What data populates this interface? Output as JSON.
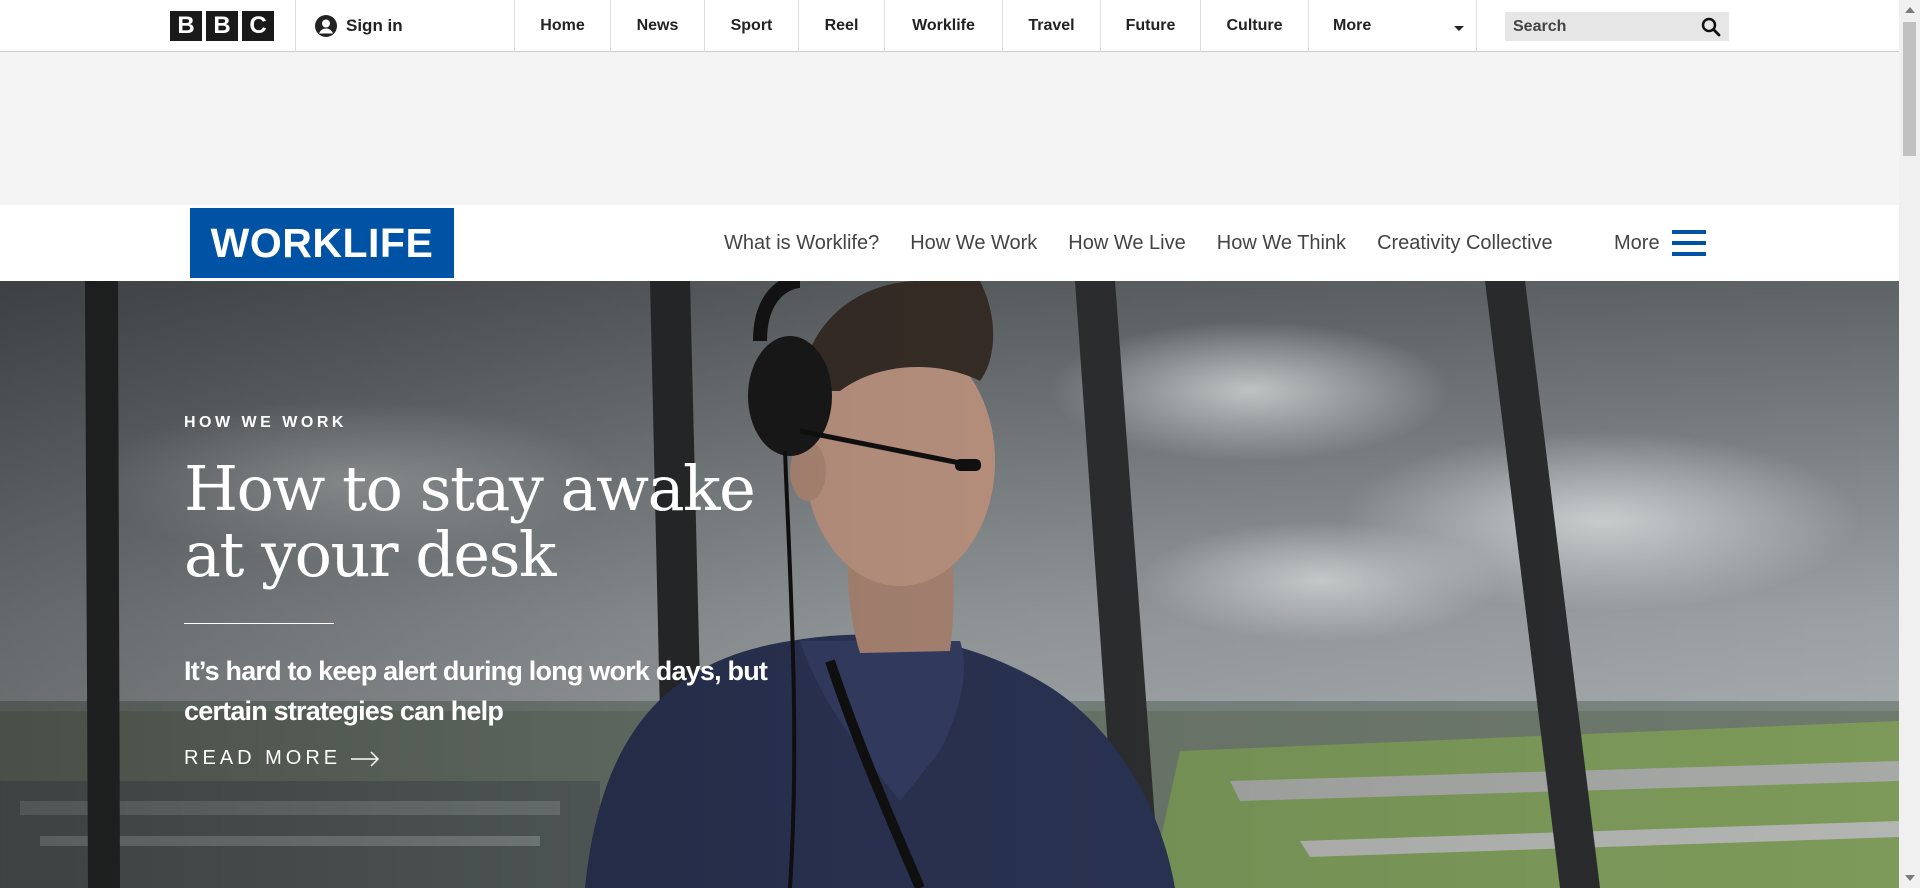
{
  "bbc": {
    "logo_letters": [
      "B",
      "B",
      "C"
    ],
    "sign_in": "Sign in",
    "nav": [
      {
        "label": "Home"
      },
      {
        "label": "News"
      },
      {
        "label": "Sport"
      },
      {
        "label": "Reel"
      },
      {
        "label": "Worklife"
      },
      {
        "label": "Travel"
      },
      {
        "label": "Future"
      },
      {
        "label": "Culture"
      }
    ],
    "more_label": "More",
    "search_label": "Search"
  },
  "worklife": {
    "logo": "WORKLIFE",
    "nav": [
      {
        "label": "What is Worklife?"
      },
      {
        "label": "How We Work"
      },
      {
        "label": "How We Live"
      },
      {
        "label": "How We Think"
      },
      {
        "label": "Creativity Collective"
      }
    ],
    "more_label": "More"
  },
  "hero": {
    "kicker": "HOW WE WORK",
    "headline": "How to stay awake at your desk",
    "subhead": "It’s hard to keep alert during long work days, but certain strategies can help",
    "read_more": "READ MORE"
  },
  "colors": {
    "brand_blue": "#0052a5",
    "bbc_black": "#1a1a1a"
  },
  "icons": [
    "user-icon",
    "chevron-down-icon",
    "search-icon",
    "hamburger-icon",
    "arrow-right-icon"
  ]
}
